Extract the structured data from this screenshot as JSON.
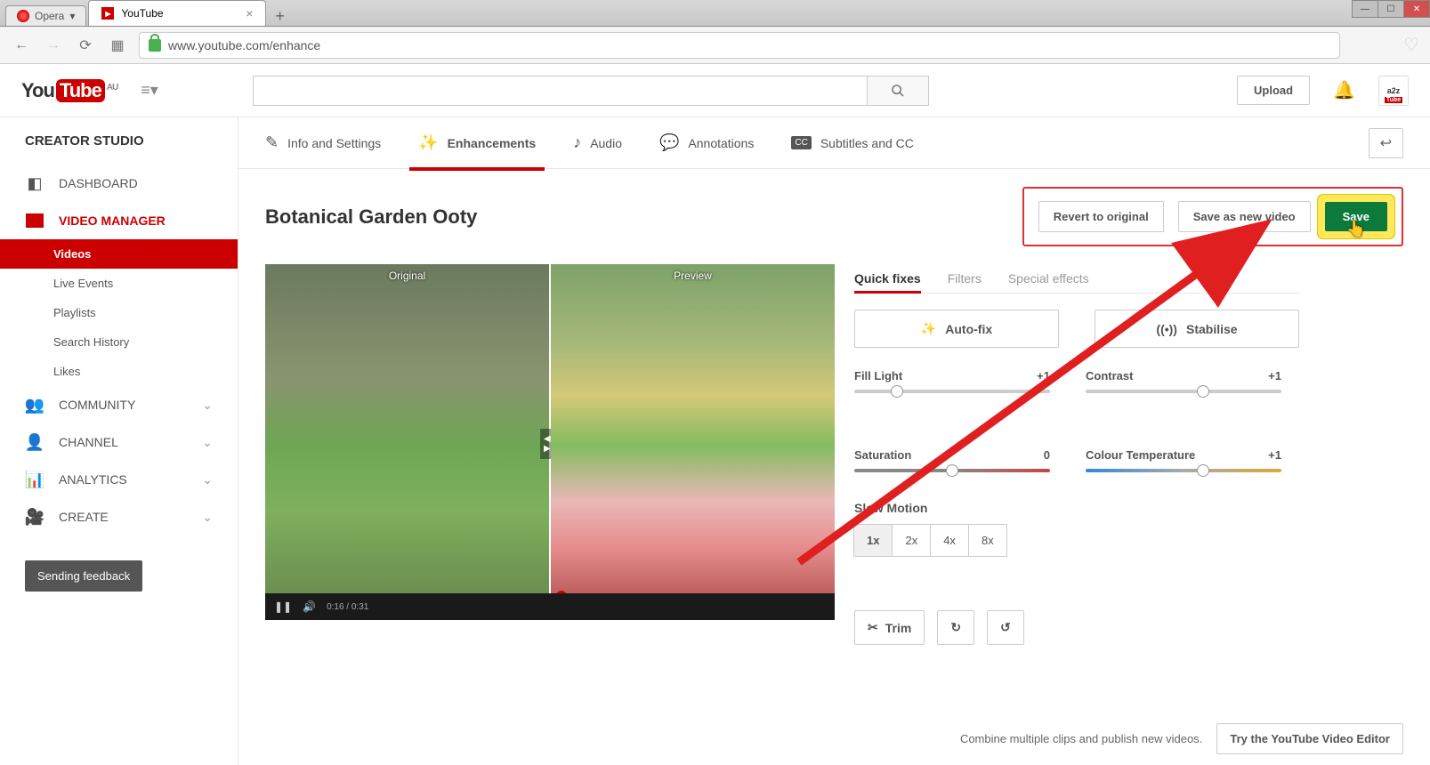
{
  "browser": {
    "opera_label": "Opera",
    "tab_title": "YouTube",
    "url": "www.youtube.com/enhance"
  },
  "header": {
    "logo_you": "You",
    "logo_tube": "Tube",
    "region": "AU",
    "upload": "Upload",
    "avatar_top": "a2z",
    "avatar_bottom": "Tube"
  },
  "sidebar": {
    "title": "CREATOR STUDIO",
    "dashboard": "DASHBOARD",
    "video_manager": "VIDEO MANAGER",
    "sub": {
      "videos": "Videos",
      "live": "Live Events",
      "playlists": "Playlists",
      "search": "Search History",
      "likes": "Likes"
    },
    "community": "COMMUNITY",
    "channel": "CHANNEL",
    "analytics": "ANALYTICS",
    "create": "CREATE",
    "feedback": "Sending feedback"
  },
  "tabs": {
    "info": "Info and Settings",
    "enhance": "Enhancements",
    "audio": "Audio",
    "annotations": "Annotations",
    "subtitles": "Subtitles and CC"
  },
  "video": {
    "title": "Botanical Garden Ooty",
    "revert": "Revert to original",
    "save_new": "Save as new video",
    "save": "Save",
    "original_label": "Original",
    "preview_label": "Preview",
    "time": "0:16 / 0:31"
  },
  "panel": {
    "quick": "Quick fixes",
    "filters": "Filters",
    "special": "Special effects",
    "autofix": "Auto-fix",
    "stabilise": "Stabilise",
    "fill_light": "Fill Light",
    "fill_light_val": "+1",
    "contrast": "Contrast",
    "contrast_val": "+1",
    "saturation": "Saturation",
    "saturation_val": "0",
    "temperature": "Colour Temperature",
    "temperature_val": "+1",
    "slow_motion": "Slow Motion",
    "speeds": {
      "x1": "1x",
      "x2": "2x",
      "x4": "4x",
      "x8": "8x"
    },
    "trim": "Trim"
  },
  "footer": {
    "text": "Combine multiple clips and publish new videos.",
    "try": "Try the YouTube Video Editor"
  }
}
